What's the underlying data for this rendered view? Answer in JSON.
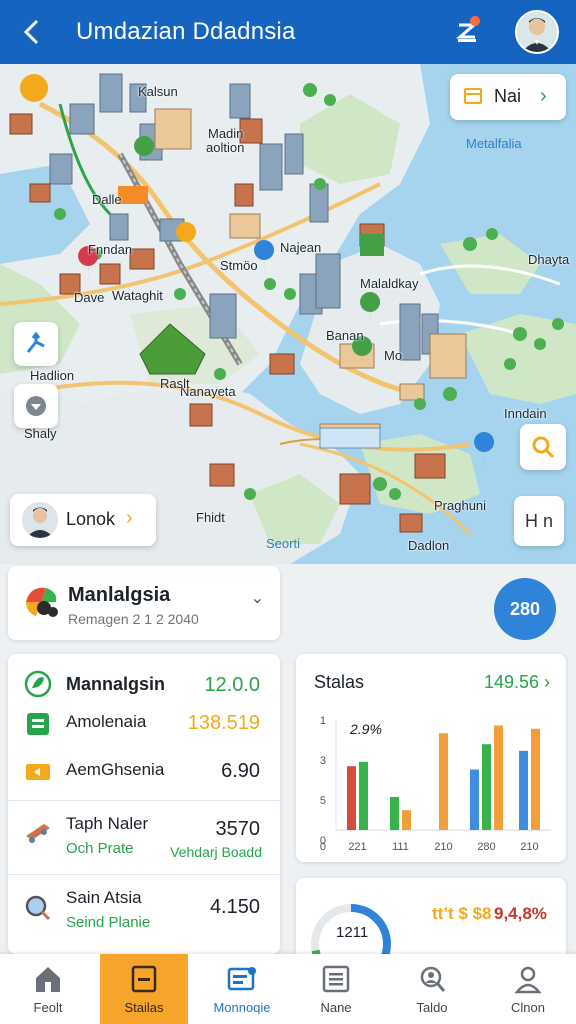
{
  "header": {
    "title": "Umdazian Ddadnsia"
  },
  "map": {
    "labels": [
      "Kalsun",
      "Madin",
      "aoltion",
      "Dalle",
      "Fnndan",
      "Dave",
      "Wataghit",
      "Stmöo",
      "Najean",
      "Malaldkay",
      "Banan",
      "Mo",
      "Dhayta",
      "Metalfalia",
      "Hadlion",
      "Shaly",
      "Nanayeta",
      "Raslt",
      "Inndain",
      "Praghuni",
      "Fhidt",
      "Dadlon",
      "Seorti"
    ],
    "top_card_label": "Nai",
    "user_chip_label": "Lonok",
    "zoom_in_icon": "zoom-icon",
    "side_label": "H n"
  },
  "location": {
    "name": "Manlalgsia",
    "subtitle": "Remagen 2 1 2 2040",
    "badge": "280"
  },
  "list": [
    {
      "title": "Mannalgsin",
      "value": "12.0.0",
      "value_color": "#27a44a"
    },
    {
      "title": "Amolenaia",
      "value": "138.519",
      "value_color": "#f4a91c"
    },
    {
      "title": "AemGhsenia",
      "value": "6.90",
      "value_color": "#1d232b"
    },
    {
      "title": "Taph Naler",
      "subtitle": "Och Prate",
      "value": "3570",
      "value2": "Vehdarj Boadd",
      "value_color": "#1d232b"
    },
    {
      "title": "Sain Atsia",
      "subtitle": "Seind Planie",
      "value": "4.150",
      "value_color": "#1d232b"
    }
  ],
  "chart_data": {
    "type": "bar",
    "title": "Stalas",
    "header_value": "149.56",
    "annotation": "2.9%",
    "y_tick_labels": [
      "0",
      "5",
      "3",
      "1"
    ],
    "categories": [
      "221",
      "111",
      "210",
      "280",
      "210"
    ],
    "series": [
      {
        "color": "#3b8ee0",
        "values": [
          0.0,
          0.0,
          0.0,
          0.55,
          0.72
        ]
      },
      {
        "color": "#d94a3b",
        "values": [
          0.58,
          0.0,
          0.0,
          0.0,
          0.0
        ]
      },
      {
        "color": "#37b24d",
        "values": [
          0.62,
          0.3,
          0.0,
          0.78,
          0.0
        ]
      },
      {
        "color": "#f29f3a",
        "values": [
          0.0,
          0.18,
          0.88,
          0.95,
          0.92
        ]
      }
    ],
    "ylim": [
      0,
      1
    ]
  },
  "donut": {
    "value": "1211",
    "label_a": "tt’t $ $8",
    "label_b": "9,4,8%",
    "percent": 0.72,
    "colors": [
      "#2f84d9",
      "#f4a91c",
      "#37b24d"
    ]
  },
  "nav": [
    {
      "label": "Feolt",
      "icon": "home-icon"
    },
    {
      "label": "Stailas",
      "icon": "tablet-icon"
    },
    {
      "label": "Monnoqie",
      "icon": "news-icon"
    },
    {
      "label": "Nane",
      "icon": "list-icon"
    },
    {
      "label": "Taldo",
      "icon": "search-person-icon"
    },
    {
      "label": "Clnon",
      "icon": "profile-icon"
    }
  ]
}
